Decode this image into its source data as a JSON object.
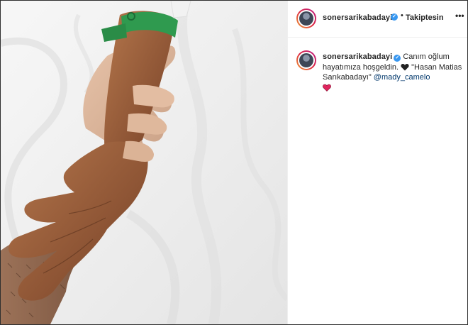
{
  "post": {
    "username": "sonersarikabadayi",
    "verified": true,
    "follow_separator": "•",
    "follow_status": "Takiptesin",
    "more_options": "•••"
  },
  "caption": {
    "username": "sonersarikabadayi",
    "line1": "Canım oğlum hayatımıza hoşgeldin.",
    "emoji_black_heart": "black-heart-icon",
    "line2": "\"Hasan Matias Sarıkabadayı\"",
    "mention": "@mady_camelo",
    "emoji_red_heart": "red-heart-icon"
  },
  "colors": {
    "accent_verified": "#3897f0",
    "mention": "#00376b",
    "text": "#262626",
    "wristband": "#2f9a4f"
  }
}
